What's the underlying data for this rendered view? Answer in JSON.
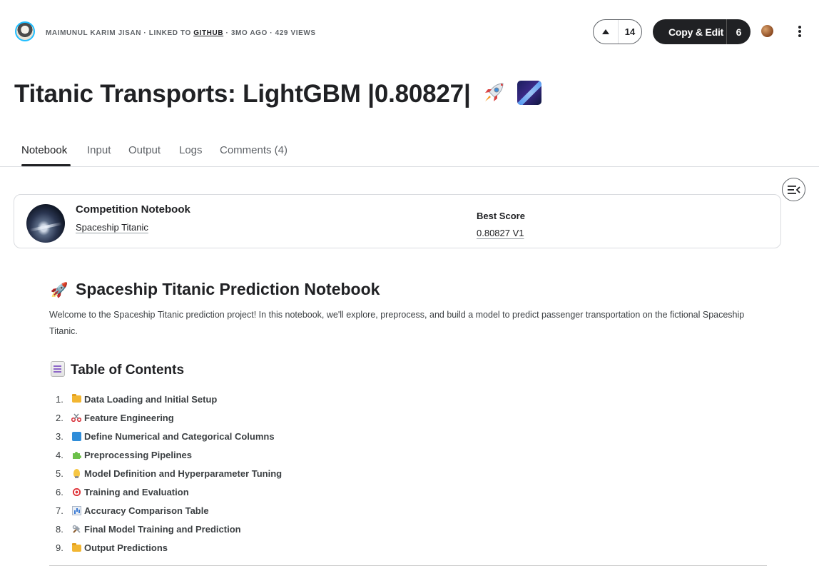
{
  "header": {
    "author": "MAIMUNUL KARIM JISAN",
    "sep1": " · LINKED TO ",
    "linked_service": "GITHUB",
    "sep2": " · 3MO AGO · 429 VIEWS",
    "upvote_count": "14",
    "copy_edit_label": "Copy & Edit",
    "copy_edit_count": "6"
  },
  "title": "Titanic Transports: LightGBM |0.80827|",
  "tabs": [
    "Notebook",
    "Input",
    "Output",
    "Logs",
    "Comments (4)"
  ],
  "active_tab": "Notebook",
  "card": {
    "title": "Competition Notebook",
    "competition": "Spaceship Titanic",
    "score_title": "Best Score",
    "score_value": "0.80827 V1"
  },
  "notebook": {
    "h1_icon": "🚀",
    "h1": "Spaceship Titanic Prediction Notebook",
    "intro": "Welcome to the Spaceship Titanic prediction project! In this notebook, we'll explore, preprocess, and build a model to predict passenger transportation on the fictional Spaceship Titanic.",
    "toc_title": "Table of Contents",
    "toc": [
      {
        "num": "1.",
        "icon": "folder-icon",
        "label": "Data Loading and Initial Setup"
      },
      {
        "num": "2.",
        "icon": "scissors-icon",
        "label": "Feature Engineering"
      },
      {
        "num": "3.",
        "icon": "numbers-icon",
        "label": "Define Numerical and Categorical Columns"
      },
      {
        "num": "4.",
        "icon": "puzzle-icon",
        "label": "Preprocessing Pipelines"
      },
      {
        "num": "5.",
        "icon": "lightbulb-icon",
        "label": "Model Definition and Hyperparameter Tuning"
      },
      {
        "num": "6.",
        "icon": "target-icon",
        "label": "Training and Evaluation"
      },
      {
        "num": "7.",
        "icon": "bar-chart-icon",
        "label": "Accuracy Comparison Table"
      },
      {
        "num": "8.",
        "icon": "tools-icon",
        "label": "Final Model Training and Prediction"
      },
      {
        "num": "9.",
        "icon": "folder-icon",
        "label": "Output Predictions"
      }
    ]
  }
}
